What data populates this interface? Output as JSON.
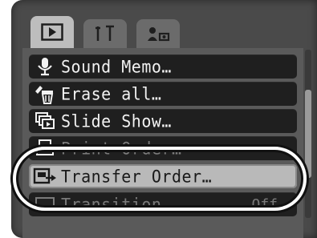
{
  "tabs": [
    {
      "icon": "play-icon",
      "active": true
    },
    {
      "icon": "tools-icon",
      "active": false
    },
    {
      "icon": "my-menu-icon",
      "active": false
    }
  ],
  "menu": {
    "items": [
      {
        "icon": "microphone-icon",
        "label": "Sound Memo…",
        "value": ""
      },
      {
        "icon": "erase-all-icon",
        "label": "Erase all…",
        "value": ""
      },
      {
        "icon": "slide-show-icon",
        "label": "Slide Show…",
        "value": ""
      },
      {
        "icon": "print-order-icon",
        "label": "Print Order…",
        "value": ""
      },
      {
        "icon": "transfer-order-icon",
        "label": "Transfer Order…",
        "value": ""
      },
      {
        "icon": "transition-icon",
        "label": "Transition",
        "value": "Off"
      }
    ],
    "selected_index": 4
  },
  "scrollbar": {
    "position_fraction": 0.45
  }
}
